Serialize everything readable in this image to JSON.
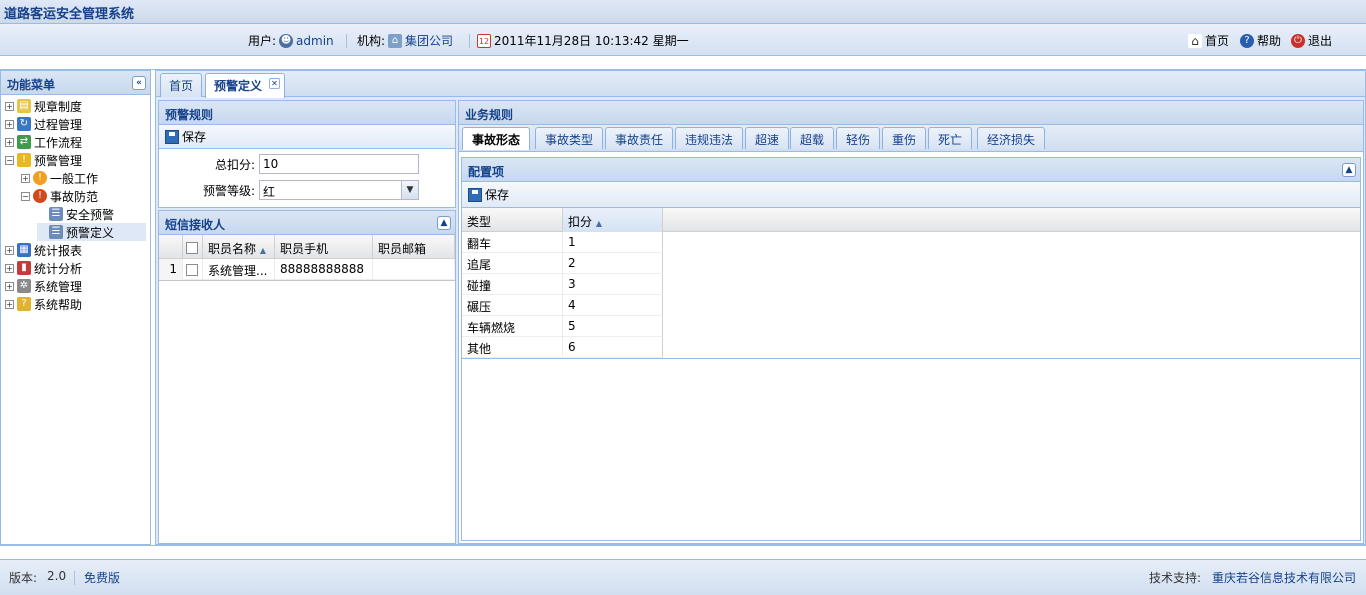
{
  "app": {
    "title": "道路客运安全管理系统"
  },
  "header": {
    "user_label": "用户:",
    "user_name": "admin",
    "org_label": "机构:",
    "org_name": "集团公司",
    "datetime": "2011年11月28日  10:13:42 星期一",
    "home": "首页",
    "help": "帮助",
    "logout": "退出"
  },
  "sidebar": {
    "title": "功能菜单",
    "items": [
      {
        "label": "规章制度",
        "icon": "document-icon"
      },
      {
        "label": "过程管理",
        "icon": "process-icon"
      },
      {
        "label": "工作流程",
        "icon": "workflow-icon"
      },
      {
        "label": "预警管理",
        "icon": "warning-icon"
      },
      {
        "label": "一般工作",
        "icon": "info-icon"
      },
      {
        "label": "事故防范",
        "icon": "alert-icon"
      },
      {
        "label": "安全预警",
        "icon": "form-icon"
      },
      {
        "label": "预警定义",
        "icon": "form-icon"
      },
      {
        "label": "统计报表",
        "icon": "report-icon"
      },
      {
        "label": "统计分析",
        "icon": "bar-chart-icon"
      },
      {
        "label": "系统管理",
        "icon": "gear-icon"
      },
      {
        "label": "系统帮助",
        "icon": "help-icon"
      }
    ]
  },
  "tabs": {
    "home": "首页",
    "active": "预警定义"
  },
  "warning_rule": {
    "title": "预警规则",
    "save": "保存",
    "total_label": "总扣分:",
    "total_value": "10",
    "level_label": "预警等级:",
    "level_value": "红"
  },
  "sms": {
    "title": "短信接收人",
    "columns": [
      "职员名称",
      "职员手机",
      "职员邮箱"
    ],
    "rows": [
      {
        "num": "1",
        "name": "系统管理...",
        "phone": "88888888888",
        "email": ""
      }
    ]
  },
  "business": {
    "title": "业务规则",
    "tabs": [
      "事故形态",
      "事故类型",
      "事故责任",
      "违规违法",
      "超速",
      "超载",
      "轻伤",
      "重伤",
      "死亡",
      "经济损失"
    ]
  },
  "config": {
    "title": "配置项",
    "save": "保存",
    "columns": [
      "类型",
      "扣分"
    ],
    "rows": [
      {
        "type": "翻车",
        "score": "1"
      },
      {
        "type": "追尾",
        "score": "2"
      },
      {
        "type": "碰撞",
        "score": "3"
      },
      {
        "type": "碾压",
        "score": "4"
      },
      {
        "type": "车辆燃烧",
        "score": "5"
      },
      {
        "type": "其他",
        "score": "6"
      }
    ]
  },
  "footer": {
    "version_label": "版本:",
    "version": "2.0",
    "edition": "免费版",
    "support_label": "技术支持:",
    "support": "重庆若谷信息技术有限公司"
  }
}
